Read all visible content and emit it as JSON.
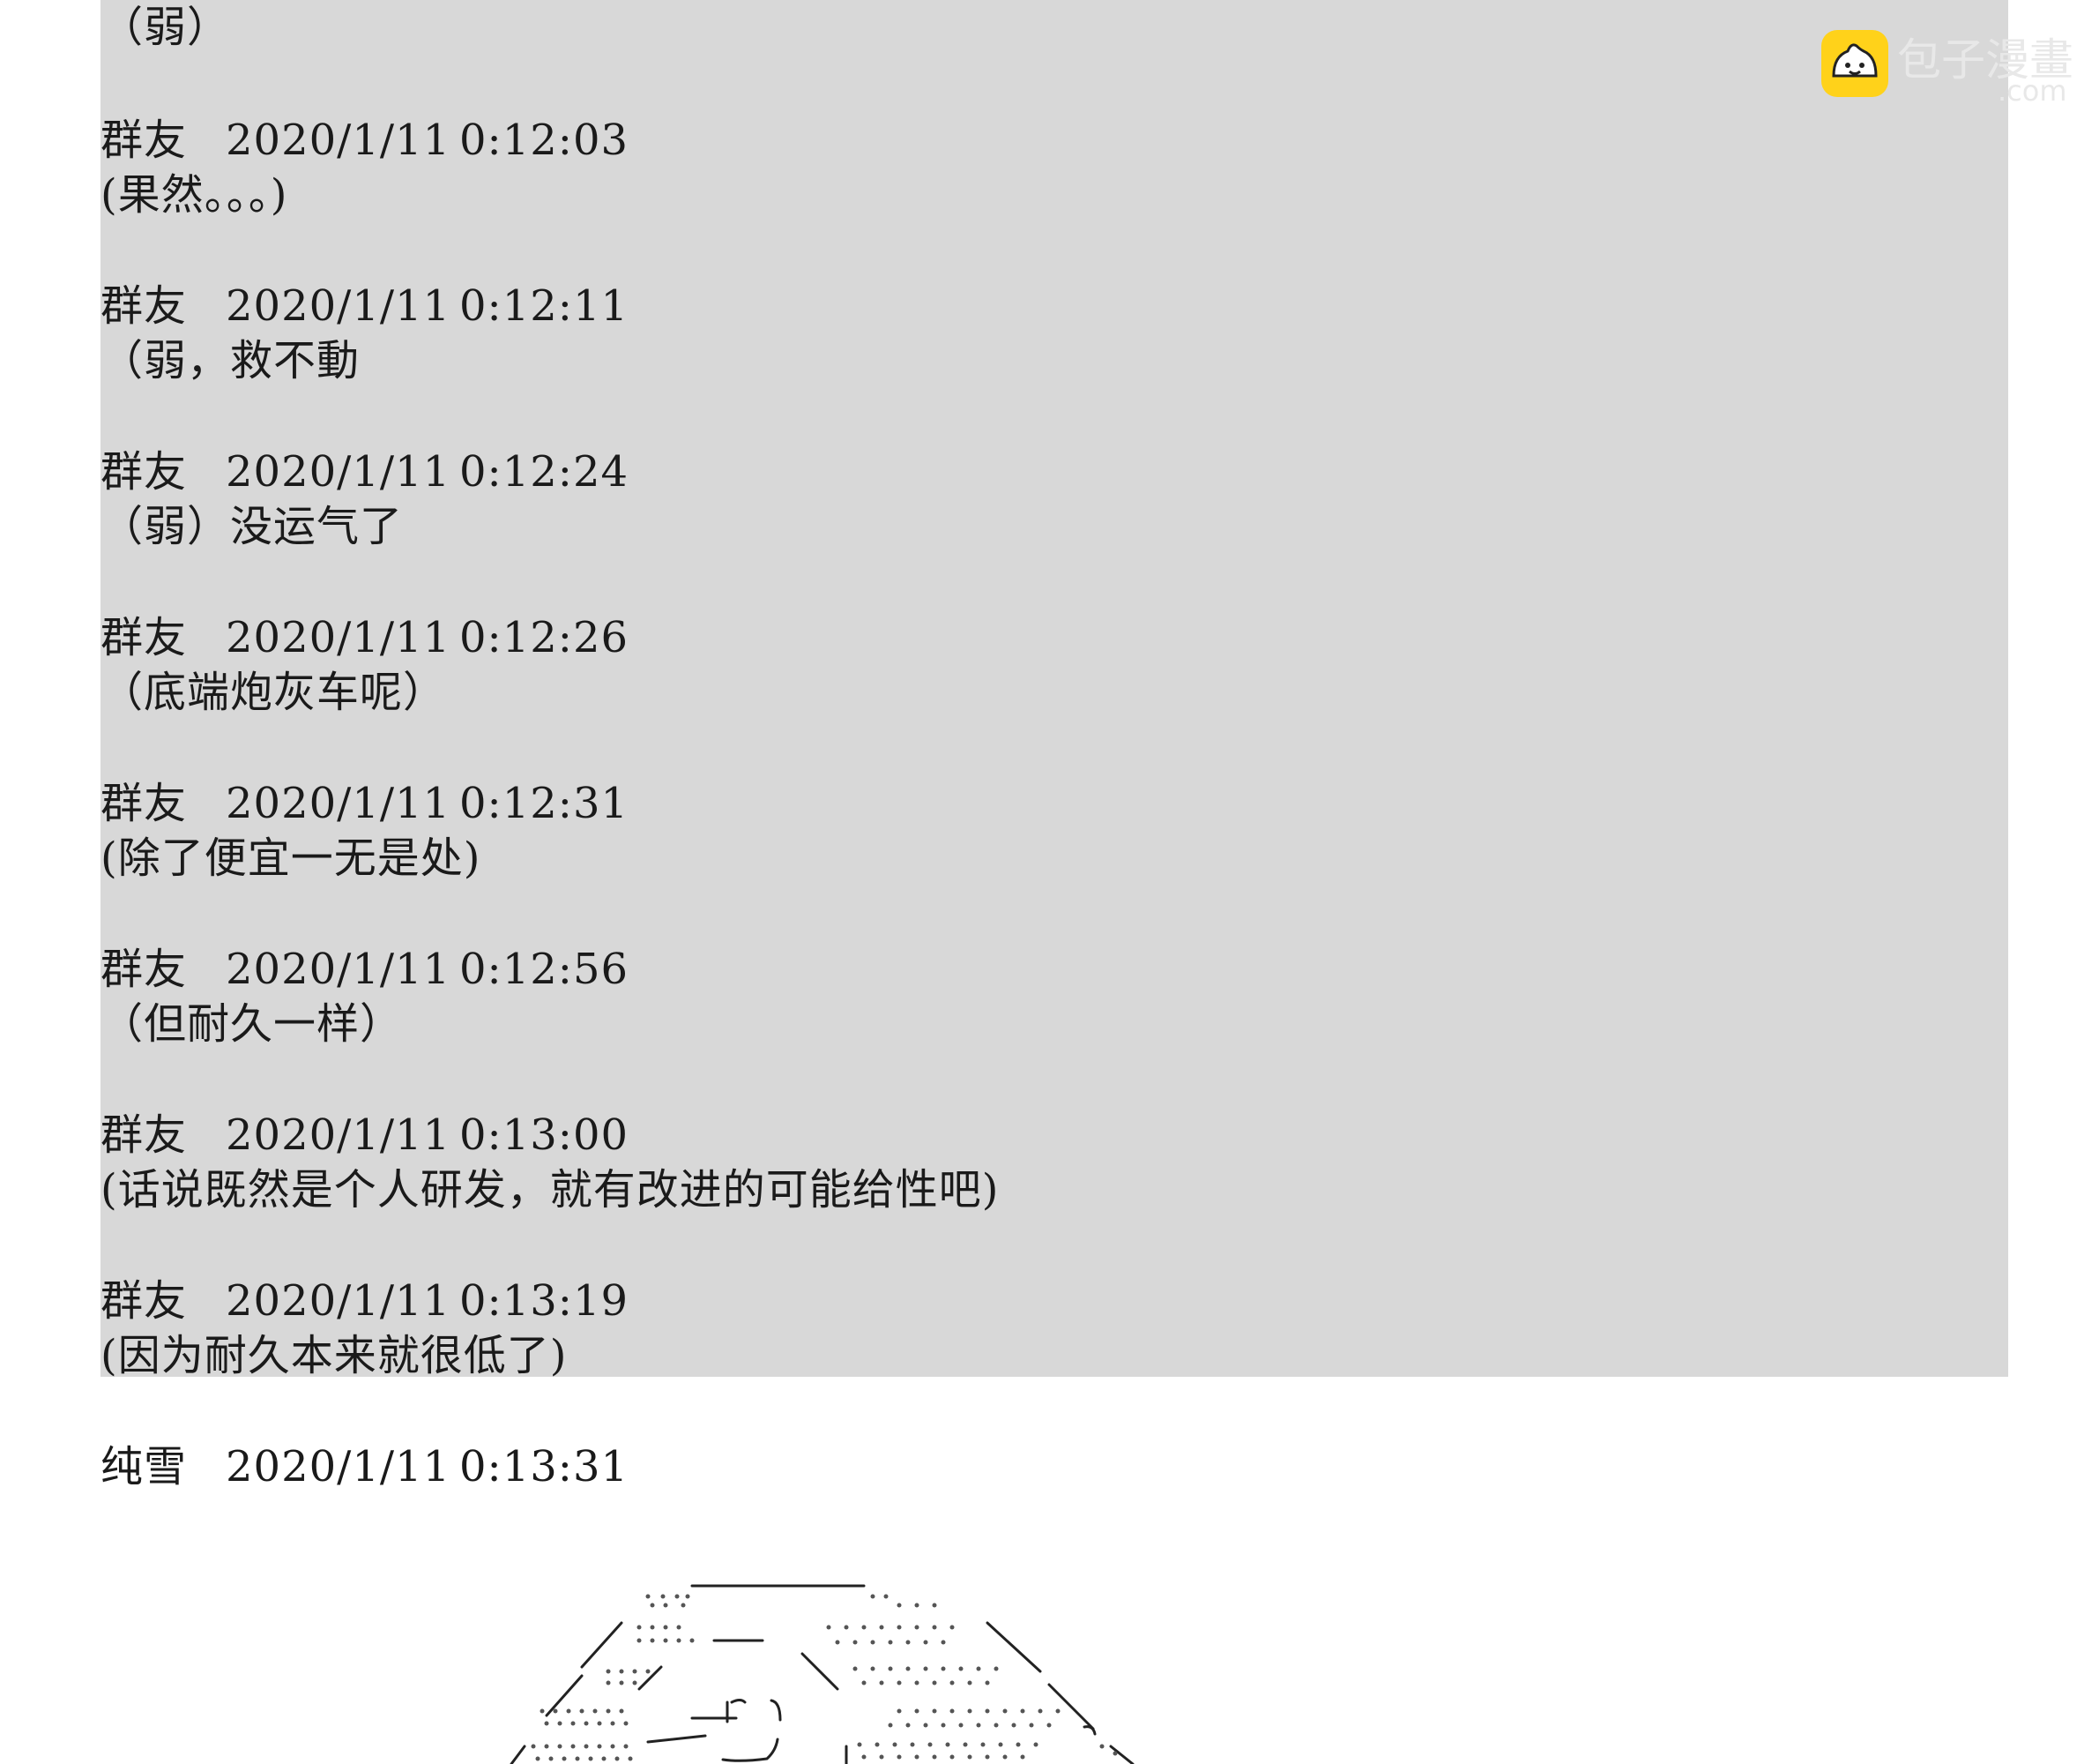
{
  "watermark": {
    "brand": "包子漫畫",
    "domain": ".com"
  },
  "messages": [
    {
      "text": "（弱）"
    },
    {
      "name": "群友",
      "date": "2020/1/11",
      "time": "0:12:03",
      "text": "(果然。。。)"
    },
    {
      "name": "群友",
      "date": "2020/1/11",
      "time": "0:12:11",
      "text": "（弱，救不動"
    },
    {
      "name": "群友",
      "date": "2020/1/11",
      "time": "0:12:24",
      "text": "（弱）没运气了"
    },
    {
      "name": "群友",
      "date": "2020/1/11",
      "time": "0:12:26",
      "text": "（底端炮灰车呢）"
    },
    {
      "name": "群友",
      "date": "2020/1/11",
      "time": "0:12:31",
      "text": "(除了便宜一无是处)"
    },
    {
      "name": "群友",
      "date": "2020/1/11",
      "time": "0:12:56",
      "text": "（但耐久一样）"
    },
    {
      "name": "群友",
      "date": "2020/1/11",
      "time": "0:13:00",
      "text": "(话说既然是个人研发，就有改进的可能给性吧)"
    },
    {
      "name": "群友",
      "date": "2020/1/11",
      "time": "0:13:19",
      "text": "(因为耐久本来就很低了)"
    },
    {
      "name": "纯雪",
      "date": "2020/1/11",
      "time": "0:13:31"
    }
  ],
  "colors": {
    "highlight": "#d8d8d8",
    "text": "#1a1a1a",
    "logo": "#ffd21a"
  }
}
